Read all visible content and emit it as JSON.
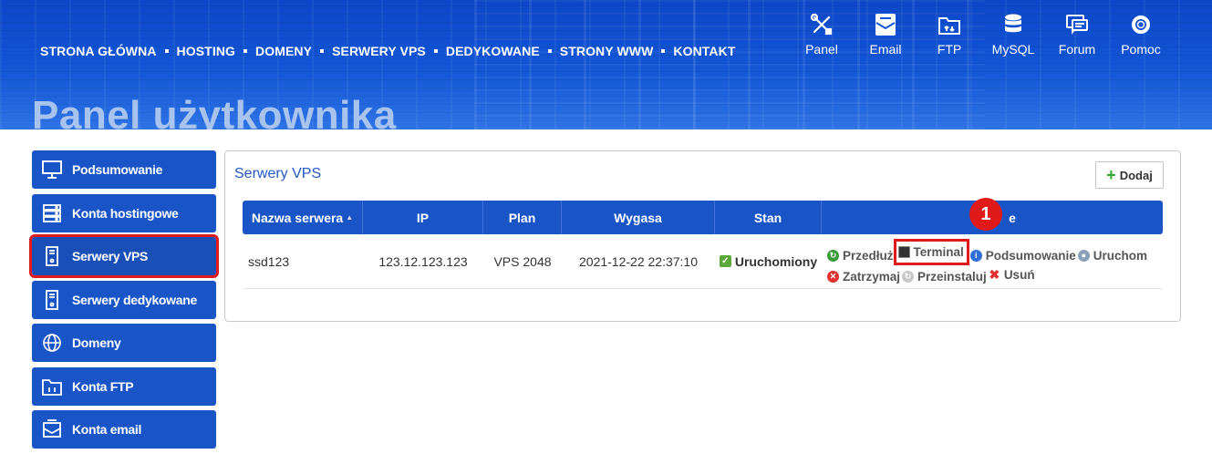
{
  "header": {
    "title": "Panel użytkownika",
    "nav": [
      "STRONA GŁÓWNA",
      "HOSTING",
      "DOMENY",
      "SERWERY VPS",
      "DEDYKOWANE",
      "STRONY WWW",
      "KONTAKT"
    ],
    "icon_nav": [
      {
        "label": "Panel",
        "icon": "tools-icon"
      },
      {
        "label": "Email",
        "icon": "email-icon"
      },
      {
        "label": "FTP",
        "icon": "ftp-folder-icon"
      },
      {
        "label": "MySQL",
        "icon": "database-icon"
      },
      {
        "label": "Forum",
        "icon": "forum-icon"
      },
      {
        "label": "Pomoc",
        "icon": "lifebuoy-icon"
      }
    ]
  },
  "sidebar": {
    "items": [
      {
        "label": "Podsumowanie",
        "icon": "monitor-icon"
      },
      {
        "label": "Konta hostingowe",
        "icon": "server-rack-icon"
      },
      {
        "label": "Serwery VPS",
        "icon": "vps-server-icon",
        "active": true
      },
      {
        "label": "Serwery dedykowane",
        "icon": "dedicated-server-icon"
      },
      {
        "label": "Domeny",
        "icon": "globe-www-icon"
      },
      {
        "label": "Konta FTP",
        "icon": "ftp-folder-icon"
      },
      {
        "label": "Konta email",
        "icon": "email-icon"
      }
    ]
  },
  "main": {
    "title": "Serwery VPS",
    "add_button": "Dodaj",
    "table": {
      "columns": [
        "Nazwa serwera",
        "IP",
        "Plan",
        "Wygasa",
        "Stan",
        "e"
      ],
      "rows": [
        {
          "name": "ssd123",
          "ip": "123.12.123.123",
          "plan": "VPS 2048",
          "expires": "2021-12-22 22:37:10",
          "status": "Uruchomiony",
          "actions": [
            "Przedłuż",
            "Terminal",
            "Podsumowanie",
            "Uruchom",
            "Zatrzymaj",
            "Przeinstaluj",
            "Usuń"
          ]
        }
      ]
    }
  },
  "annotation": {
    "step": "1"
  },
  "colors": {
    "primary": "#1a55c8",
    "highlight": "#e01919",
    "title": "#a8c4ee"
  }
}
